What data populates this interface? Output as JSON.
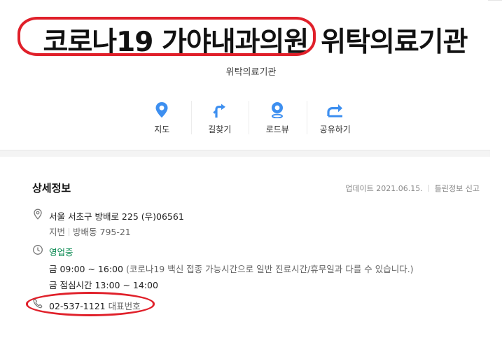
{
  "header": {
    "place_name": "코로나19 가야내과의원",
    "place_suffix": "위탁의료기관",
    "category": "위탁의료기관"
  },
  "actions": [
    {
      "label": "지도",
      "icon": "map-pin-icon"
    },
    {
      "label": "길찾기",
      "icon": "directions-icon"
    },
    {
      "label": "로드뷰",
      "icon": "roadview-icon"
    },
    {
      "label": "공유하기",
      "icon": "share-icon"
    }
  ],
  "details": {
    "heading": "상세정보",
    "updated": "업데이트 2021.06.15.",
    "report_link": "틀린정보 신고",
    "address": "서울 서초구 방배로 225 (우)06561",
    "lot_label": "지번",
    "lot_value": "방배동 795-21",
    "status": "영업중",
    "hours_fri": "금  09:00 ~ 16:00",
    "hours_note": "(코로나19 백신 접종 가능시간으로 일반 진료시간/휴무일과 다를 수 있습니다.)",
    "hours_lunch": "금 점심시간  13:00 ~ 14:00",
    "phone": "02-537-1121",
    "phone_label": "대표번호"
  },
  "colors": {
    "accent_blue": "#3d8ff0",
    "open_green": "#0b8a52",
    "highlight_red": "#e0202a"
  }
}
